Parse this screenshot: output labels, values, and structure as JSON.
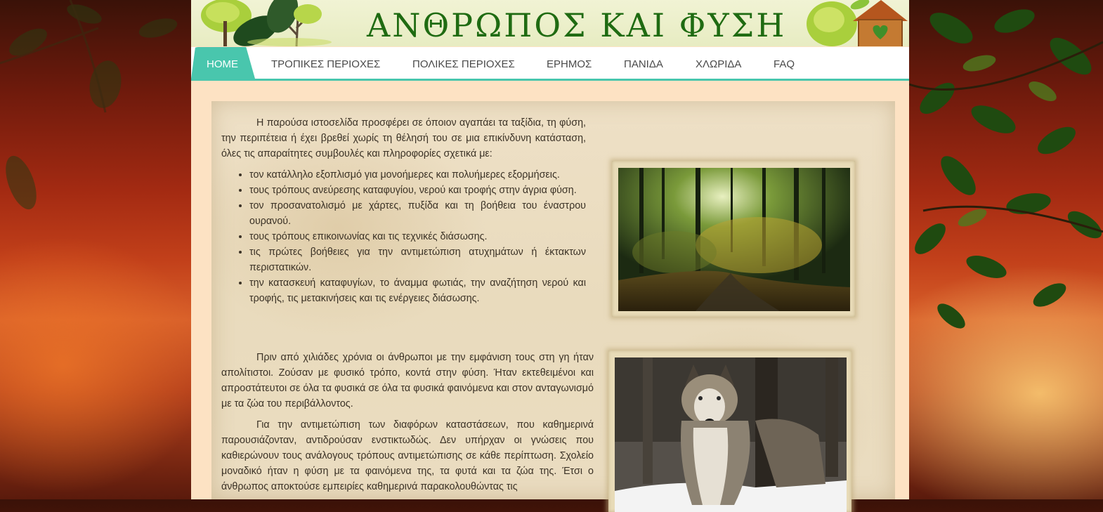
{
  "site": {
    "title": "ΑΝΘΡΩΠΟΣ ΚΑΙ ΦΥΣΗ"
  },
  "nav": {
    "items": [
      {
        "label": "HOME",
        "active": true
      },
      {
        "label": "ΤΡΟΠΙΚΕΣ ΠΕΡΙΟΧΕΣ"
      },
      {
        "label": "ΠΟΛΙΚΕΣ ΠΕΡΙΟΧΕΣ"
      },
      {
        "label": "ΕΡΗΜΟΣ"
      },
      {
        "label": "ΠΑΝΙΔΑ"
      },
      {
        "label": "ΧΛΩΡΙΔΑ"
      },
      {
        "label": "FAQ"
      }
    ]
  },
  "intro": {
    "paragraph": "Η παρούσα ιστοσελίδα προσφέρει σε όποιον αγαπάει τα ταξίδια, τη φύση, την περιπέτεια ή έχει βρεθεί χωρίς τη θέλησή του σε μια επικίνδυνη κατάσταση, όλες τις απαραίτητες συμβουλές και πληροφορίες σχετικά με:",
    "list": [
      "τον κατάλληλο εξοπλισμό για μονοήμερες και πολυήμερες εξορμήσεις.",
      "τους τρόπους ανεύρεσης καταφυγίου, νερού και τροφής στην άγρια φύση.",
      "τον προσανατολισμό με χάρτες, πυξίδα και τη βοήθεια του έναστρου ουρανού.",
      "τους τρόπους επικοινωνίας και τις τεχνικές διάσωσης.",
      "τις πρώτες βοήθειες για την αντιμετώπιση ατυχημάτων ή έκτακτων περιστατικών.",
      "την κατασκευή καταφυγίων, το άναμμα φωτιάς, την αναζήτηση νερού και τροφής, τις μετακινήσεις και τις ενέργειες διάσωσης."
    ]
  },
  "history": {
    "paragraphs": [
      "Πριν από χιλιάδες χρόνια οι άνθρωποι με την εμφάνιση τους στη γη ήταν απολίτιστοι. Ζούσαν με φυσικό τρόπο, κοντά στην φύση. Ήταν εκτεθειμένοι και απροστάτευτοι σε όλα τα φυσικά σε όλα τα φυσικά φαινόμενα και στον ανταγωνισμό με τα ζώα του περιβάλλοντος.",
      "Για την αντιμετώπιση των διαφόρων καταστάσεων, που καθημερινά παρουσιάζονταν, αντιδρούσαν ενστικτωδώς. Δεν υπήρχαν οι γνώσεις που καθιερώνουν τους ανάλογους τρόπους αντιμετώπισης σε κάθε περίπτωση. Σχολείο μοναδικό ήταν η φύση με τα φαινόμενα της, τα φυτά και τα ζώα της. Έτσι ο άνθρωπος αποκτούσε εμπειρίες καθημερινά παρακολουθώντας τις"
    ]
  },
  "images": {
    "forest": {
      "icon": "forest-photo"
    },
    "wolf": {
      "icon": "wolf-photo"
    }
  },
  "colors": {
    "accent": "#49c6ad",
    "title": "#1f6b12",
    "page_bg": "#fde2c3",
    "text": "#3b3226"
  }
}
